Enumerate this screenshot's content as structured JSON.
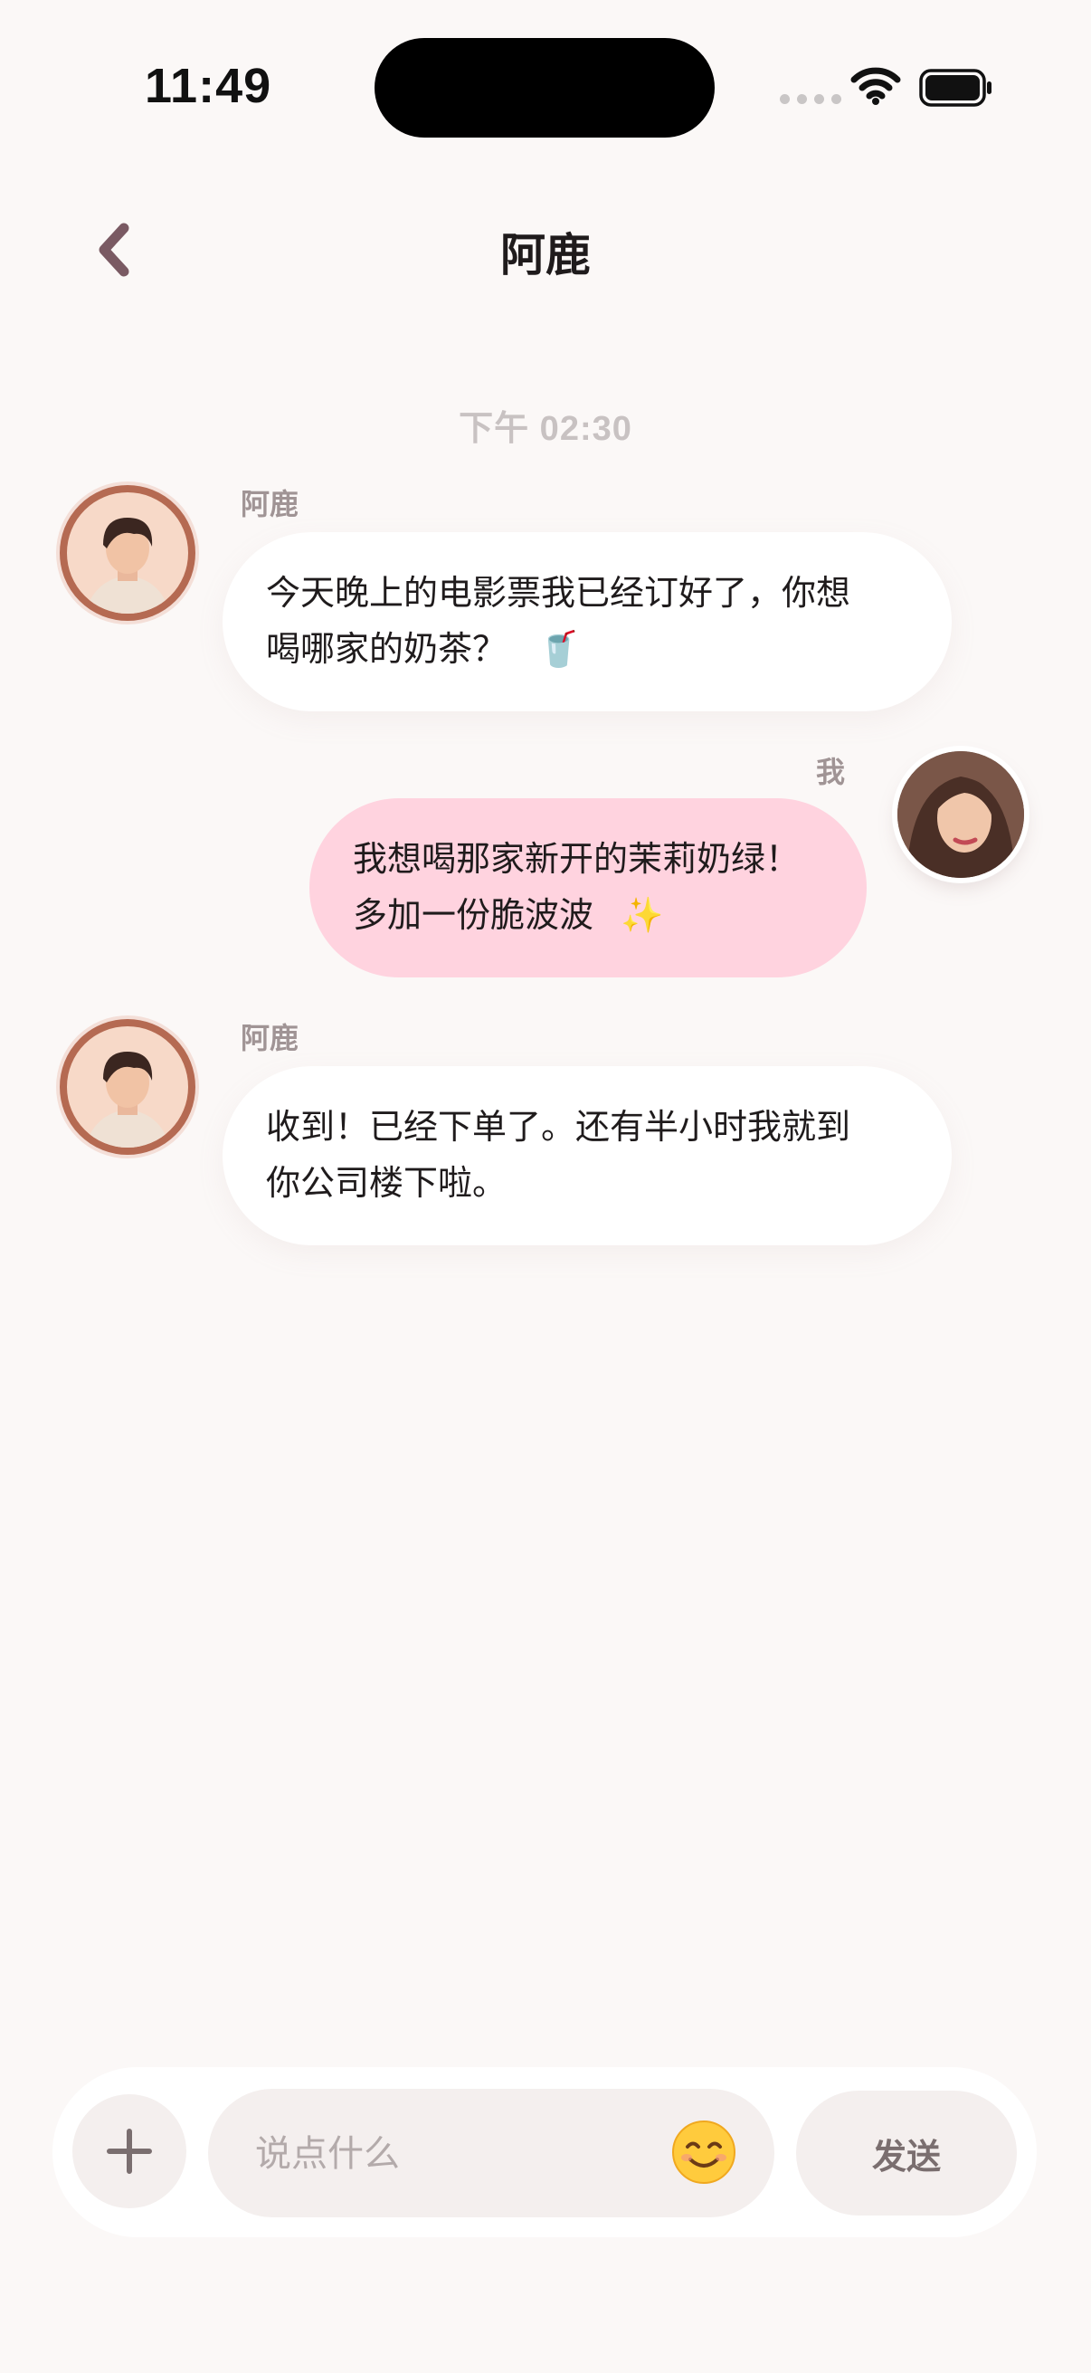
{
  "status_bar": {
    "time": "11:49"
  },
  "header": {
    "title": "阿鹿",
    "back_icon": "chevron-left-icon"
  },
  "chat": {
    "timestamp": "下午 02:30",
    "messages": [
      {
        "sender": "阿鹿",
        "from_me": false,
        "line1": "今天晚上的电影票我已经订好了，你想",
        "line2": "喝哪家的奶茶？",
        "emoji": "🥤"
      },
      {
        "sender": "我",
        "from_me": true,
        "line1": "我想喝那家新开的茉莉奶绿！",
        "line2": "多加一份脆波波",
        "emoji": "✨"
      },
      {
        "sender": "阿鹿",
        "from_me": false,
        "line1": "收到！已经下单了。还有半小时我就到",
        "line2": "你公司楼下啦。",
        "emoji": ""
      }
    ]
  },
  "composer": {
    "placeholder": "说点什么",
    "send_label": "发送",
    "plus_icon": "plus-icon",
    "emoji_icon": "smiling-face-icon"
  },
  "colors": {
    "background": "#fbf8f7",
    "bubble_them": "#ffffff",
    "bubble_me": "#ffd3df",
    "accent_back": "#7a5a63"
  }
}
